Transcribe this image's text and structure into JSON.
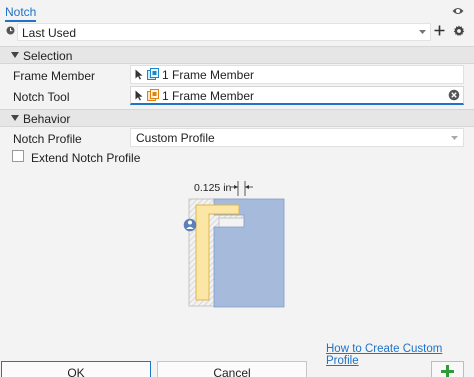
{
  "header": {
    "title": "Notch"
  },
  "preset": {
    "value": "Last Used"
  },
  "sections": {
    "selection": "Selection",
    "behavior": "Behavior"
  },
  "selection": {
    "frame_member": {
      "label": "Frame Member",
      "value": "1 Frame Member"
    },
    "notch_tool": {
      "label": "Notch Tool",
      "value": "1 Frame Member"
    }
  },
  "behavior": {
    "notch_profile": {
      "label": "Notch Profile",
      "value": "Custom Profile"
    },
    "extend_notch_profile": {
      "label": "Extend Notch Profile",
      "checked": false
    }
  },
  "diagram": {
    "dimension": "0.125 in"
  },
  "footer": {
    "help_link": "How to Create Custom Profile",
    "ok": "OK",
    "cancel": "Cancel"
  },
  "colors": {
    "accent": "#1f73c8",
    "profile_fill": "#fbe6a6",
    "tool_fill": "#a6bbdc",
    "add_green": "#2e9b3a"
  },
  "icons": [
    "eye-icon",
    "clock-icon",
    "plus-icon",
    "gear-icon",
    "cursor-icon",
    "frame-member-icon",
    "notch-tool-icon",
    "clear-icon",
    "chevron-down-icon",
    "person-icon"
  ]
}
